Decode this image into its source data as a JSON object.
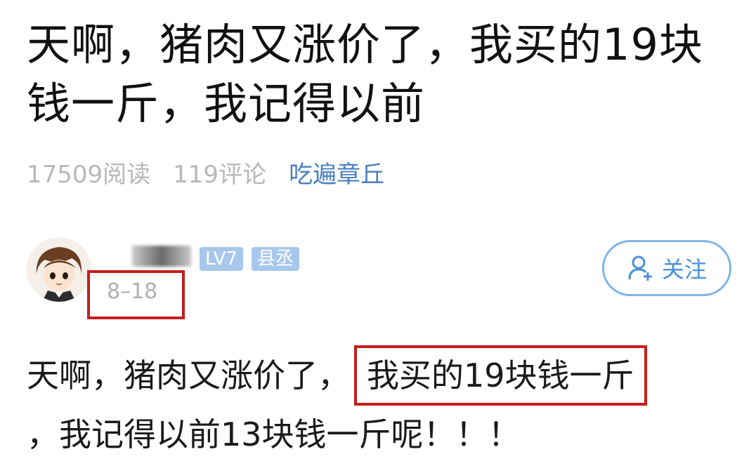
{
  "post": {
    "title": "天啊，猪肉又涨价了，我买的19块钱一斤，我记得以前",
    "reads": "17509阅读",
    "comments": "119评论",
    "topic": "吃遍章丘"
  },
  "comment": {
    "level": "LV7",
    "rank": "县丞",
    "date": "8–18",
    "follow_label": "关注",
    "text_before": "天啊，猪肉又涨价了，",
    "text_highlight": "我买的19块钱一斤",
    "text_after": "，我记得以前13块钱一斤呢！！！"
  },
  "colors": {
    "highlight_box": "#c71d1d",
    "topic_link": "#4a7fc1",
    "badge_bg": "#a8c7ec",
    "follow_border": "#7fb4e6"
  },
  "icons": {
    "follow": "add-user-icon"
  }
}
